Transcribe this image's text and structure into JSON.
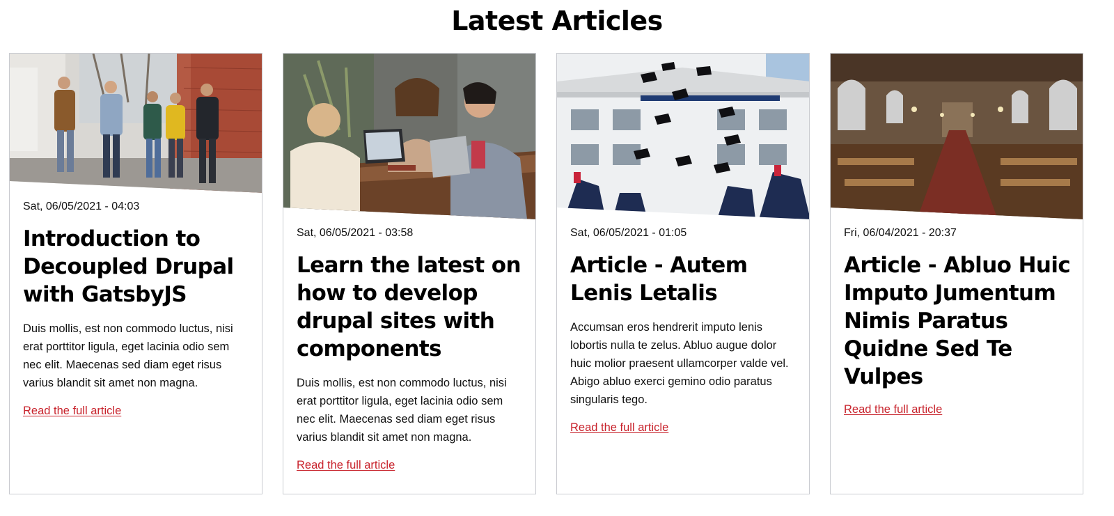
{
  "header": {
    "title": "Latest Articles"
  },
  "cards": [
    {
      "date": "Sat, 06/05/2021 - 04:03",
      "title": "Introduction to Decoupled Drupal with GatsbyJS",
      "summary": "Duis mollis, est non commodo luctus, nisi erat porttitor ligula, eget lacinia odio sem nec elit. Maecenas sed diam eget risus varius blandit sit amet non magna.",
      "link": "Read the full article",
      "image": "photo-students-walking"
    },
    {
      "date": "Sat, 06/05/2021 - 03:58",
      "title": "Learn the latest on how to develop drupal sites with components",
      "summary": "Duis mollis, est non commodo luctus, nisi erat porttitor ligula, eget lacinia odio sem nec elit. Maecenas sed diam eget risus varius blandit sit amet non magna.",
      "link": "Read the full article",
      "image": "photo-people-laptops"
    },
    {
      "date": "Sat, 06/05/2021 - 01:05",
      "title": "Article - Autem Lenis Letalis",
      "summary": "Accumsan eros hendrerit imputo lenis lobortis nulla te zelus. Abluo augue dolor huic molior praesent ullamcorper valde vel. Abigo abluo exerci gemino odio paratus singularis tego.",
      "link": "Read the full article",
      "image": "photo-graduation-caps"
    },
    {
      "date": "Fri, 06/04/2021 - 20:37",
      "title": "Article - Abluo Huic Imputo Jumentum Nimis Paratus Quidne Sed Te Vulpes",
      "summary": "",
      "link": "Read the full article",
      "image": "photo-library-hall"
    }
  ],
  "colors": {
    "link": "#c8232c",
    "card_border": "#c9cbd0"
  }
}
